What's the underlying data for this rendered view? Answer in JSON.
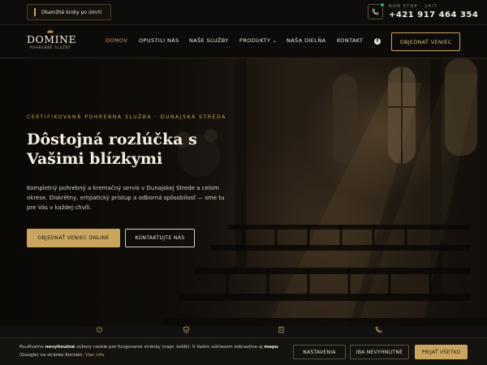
{
  "topbar": {
    "steps_label": "Okamžité kroky po úmrtí",
    "nonstop_label": "NON STOP · 24/7",
    "phone": "+421 917 464 354"
  },
  "logo": {
    "name": "DOMINE",
    "tagline": "POHREBNÉ SLUŽBY"
  },
  "nav": {
    "items": [
      {
        "label": "DOMOV",
        "active": true
      },
      {
        "label": "OPUSTILI NÁS"
      },
      {
        "label": "NAŠE SLUŽBY"
      },
      {
        "label": "PRODUKTY ⌄"
      },
      {
        "label": "NAŠA DIELŇA"
      },
      {
        "label": "KONTAKT"
      }
    ],
    "facebook_glyph": "f",
    "order_label": "OBJEDNAŤ VENIEC"
  },
  "hero": {
    "eyebrow": "CERTIFIKOVANÁ POHREBNÁ SLUŽBA · DUNAJSKÁ STREDA",
    "headline": "Dôstojná rozlúčka s Vašimi blízkymi",
    "lede": "Kompletný pohrebný a kremačný servis v Dunajskej Strede a celom okrese. Diskrétny, empatický prístup a odborná spôsobilosť — sme tu pre Vás v každej chvíli.",
    "cta_primary": "OBJEDNAŤ VENIEC ONLINE",
    "cta_secondary": "KONTAKTUJTE NÁS"
  },
  "cookie": {
    "text_before": "Používame ",
    "text_bold1": "nevyhnutné",
    "text_mid": " súbory cookie pre fungovanie stránky (napr. košík). S Vaším súhlasom zobrazíme aj ",
    "text_bold2": "mapu",
    "text_after": " (Google) na stránke Kontakt. ",
    "link": "Viac info",
    "btn_settings": "NASTAVENIA",
    "btn_necessary": "IBA NEVYHNUTNÉ",
    "btn_accept": "PRIJAŤ VŠETKO"
  },
  "colors": {
    "accent_gold": "#c9a55f",
    "background": "#0d0b09",
    "text_light": "#f4ede1",
    "status_green": "#23c35a"
  },
  "icons": [
    "candle-icon",
    "phone-icon",
    "crown-icon",
    "facebook-icon",
    "heart-icon",
    "shield-check-icon",
    "building-icon",
    "phone-icon"
  ]
}
